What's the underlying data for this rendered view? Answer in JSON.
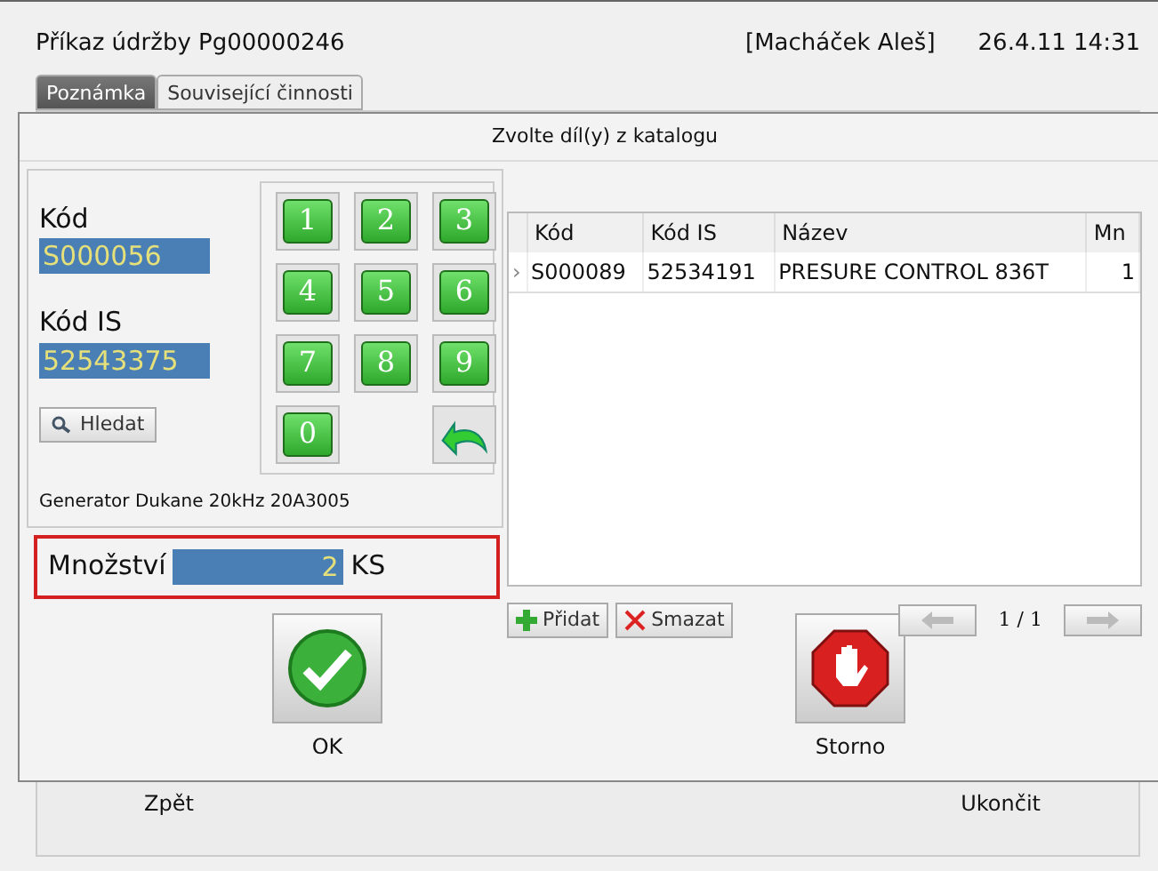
{
  "window": {
    "title": "Příkaz údržby Pg00000246",
    "user": "[Macháček Aleš]",
    "datetime": "26.4.11 14:31"
  },
  "tabs": [
    {
      "label": "Poznámka",
      "selected": true
    },
    {
      "label": "Související činnosti",
      "selected": false
    }
  ],
  "background_buttons": [
    "Zpět",
    "Ukončit"
  ],
  "dialog": {
    "title": "Zvolte díl(y) z katalogu",
    "fields": [
      {
        "label": "Kód",
        "value": "S000056"
      },
      {
        "label": "Kód IS",
        "value": "52543375"
      }
    ],
    "search_button": "Hledat",
    "keypad": [
      "1",
      "2",
      "3",
      "4",
      "5",
      "6",
      "7",
      "8",
      "9",
      "0"
    ],
    "part_name": "Generator Dukane 20kHz 20A3005",
    "quantity": {
      "label": "Množství",
      "value": "2",
      "unit": "KS"
    },
    "table": {
      "columns": [
        "Kód",
        "Kód IS",
        "Název",
        "Mn"
      ],
      "rows": [
        {
          "marker": "›",
          "cells": [
            "S000089",
            "52534191",
            "PRESURE CONTROL 836T",
            "1"
          ]
        }
      ]
    },
    "add_button": "Přidat",
    "delete_button": "Smazat",
    "page": "1 / 1",
    "buttons": [
      {
        "kind": "ok",
        "label": "OK"
      },
      {
        "kind": "cancel",
        "label": "Storno"
      }
    ]
  }
}
